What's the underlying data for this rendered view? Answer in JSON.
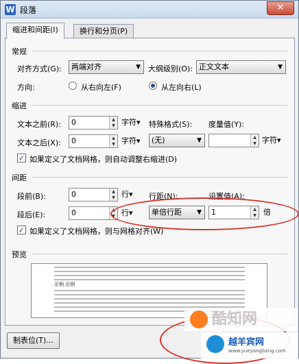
{
  "window": {
    "title": "段落",
    "close_label": "✕"
  },
  "tabs": [
    {
      "label": "缩进和间距(I)",
      "active": true
    },
    {
      "label": "换行和分页(P)",
      "active": false
    }
  ],
  "general": {
    "heading": "常规",
    "align_label": "对齐方式(G):",
    "align_value": "两端对齐",
    "outline_label": "大纲级别(O):",
    "outline_value": "正文文本",
    "direction_label": "方向:",
    "rtl_label": "从右向左(F)",
    "ltr_label": "从左向右(L)"
  },
  "indent": {
    "heading": "缩进",
    "before_label": "文本之前(R):",
    "before_value": "0",
    "before_unit": "字符▾",
    "special_label": "特殊格式(S):",
    "special_value": "(无)",
    "measure_label": "度量值(Y):",
    "measure_value": "",
    "measure_unit": "字符▾",
    "after_label": "文本之后(X):",
    "after_value": "0",
    "after_unit": "字符▾",
    "grid_check_label": "如果定义了文档网格，则自动调整右缩进(D)"
  },
  "spacing": {
    "heading": "间距",
    "before_label": "段前(B):",
    "before_value": "0",
    "before_unit": "行▾",
    "line_label": "行距(N):",
    "line_value": "单倍行距",
    "setting_label": "设置值(A):",
    "setting_value": "1",
    "setting_unit": "倍",
    "after_label": "段后(E):",
    "after_value": "0",
    "after_unit": "行▾",
    "grid_check_label": "如果定义了文档网格，则与网格对齐(W)"
  },
  "preview": {
    "heading": "预览",
    "sample_label": "示例 示例"
  },
  "buttons": {
    "tabs_label": "制表位(T)..."
  },
  "watermarks": {
    "site1": "酷知网",
    "site2": "越羊宾网",
    "site2_url": "www.yueyangbang.com"
  },
  "colors": {
    "annotation": "#d9342b",
    "radio_dot": "#2b4f94"
  }
}
